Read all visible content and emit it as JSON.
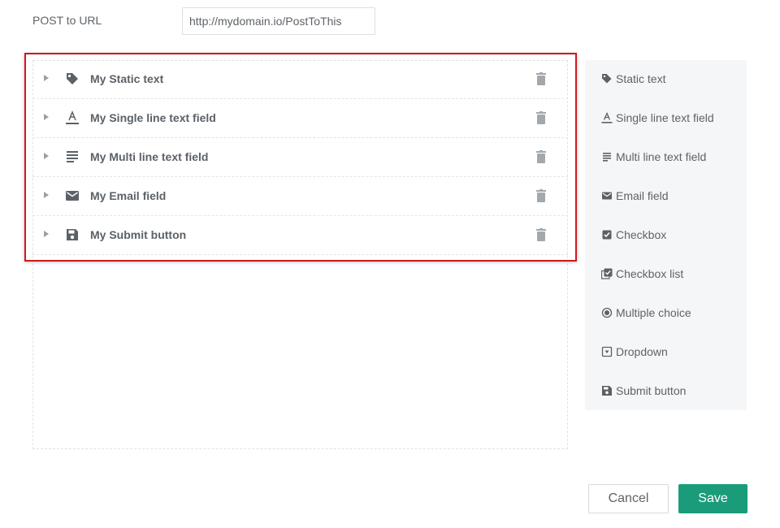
{
  "post_to_url": {
    "label": "POST to URL",
    "value": "http://mydomain.io/PostToThis"
  },
  "form_fields": [
    {
      "label": "My Static text",
      "icon": "tag-icon"
    },
    {
      "label": "My Single line text field",
      "icon": "text-format-icon"
    },
    {
      "label": "My Multi line text field",
      "icon": "paragraph-lines-icon"
    },
    {
      "label": "My Email field",
      "icon": "envelope-icon"
    },
    {
      "label": "My Submit button",
      "icon": "floppy-disk-icon"
    }
  ],
  "palette": [
    {
      "label": "Static text",
      "icon": "tag-icon"
    },
    {
      "label": "Single line text field",
      "icon": "text-format-icon"
    },
    {
      "label": "Multi line text field",
      "icon": "paragraph-lines-icon"
    },
    {
      "label": "Email field",
      "icon": "envelope-icon"
    },
    {
      "label": "Checkbox",
      "icon": "checkbox-icon"
    },
    {
      "label": "Checkbox list",
      "icon": "checkbox-list-icon"
    },
    {
      "label": "Multiple choice",
      "icon": "radio-icon"
    },
    {
      "label": "Dropdown",
      "icon": "dropdown-box-icon"
    },
    {
      "label": "Submit button",
      "icon": "floppy-disk-icon"
    }
  ],
  "actions": {
    "cancel_label": "Cancel",
    "save_label": "Save"
  },
  "colors": {
    "accent": "#1a9c7a",
    "highlight_border": "#d0181e",
    "icon": "#5b6167"
  }
}
